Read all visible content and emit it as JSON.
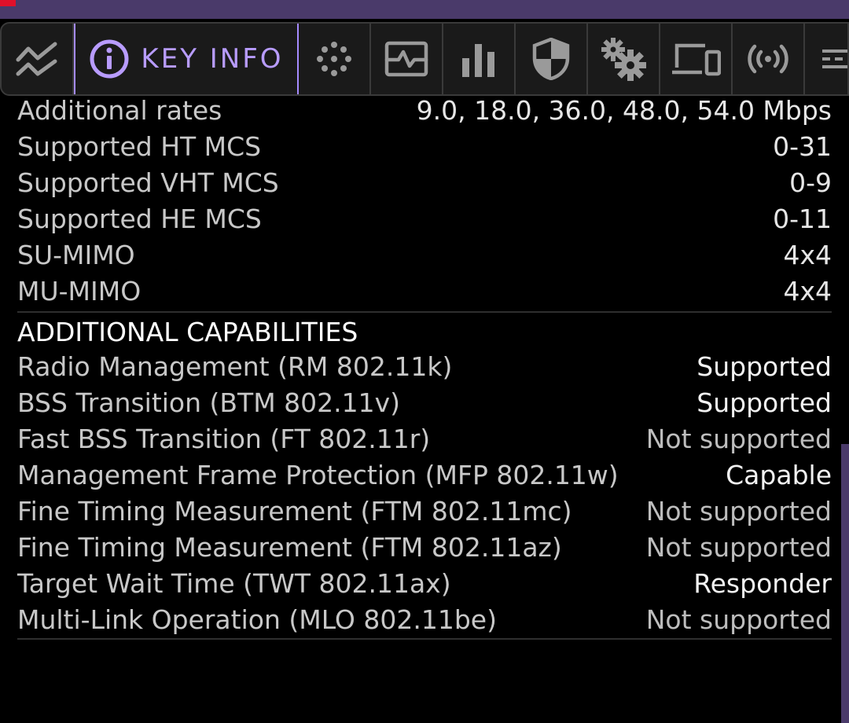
{
  "toolbar": {
    "tabs": [
      {
        "icon": "chart-line-icon"
      },
      {
        "icon": "info-circle-icon",
        "label": "KEY INFO",
        "active": true
      },
      {
        "icon": "dots-grid-icon"
      },
      {
        "icon": "signal-graph-icon"
      },
      {
        "icon": "bar-chart-icon"
      },
      {
        "icon": "shield-icon"
      },
      {
        "icon": "gears-icon"
      },
      {
        "icon": "devices-icon"
      },
      {
        "icon": "broadcast-icon"
      },
      {
        "icon": "more-icon"
      }
    ],
    "accent_color": "#a58bff"
  },
  "rates": [
    {
      "key": "Additional rates",
      "value": "9.0, 18.0, 36.0, 48.0, 54.0 Mbps"
    },
    {
      "key": "Supported HT MCS",
      "value": "0-31"
    },
    {
      "key": "Supported VHT MCS",
      "value": "0-9"
    },
    {
      "key": "Supported HE MCS",
      "value": "0-11"
    },
    {
      "key": "SU-MIMO",
      "value": "4x4"
    },
    {
      "key": "MU-MIMO",
      "value": "4x4"
    }
  ],
  "additional_capabilities": {
    "title": "ADDITIONAL CAPABILITIES",
    "items": [
      {
        "key": "Radio Management (RM 802.11k)",
        "value": "Supported"
      },
      {
        "key": "BSS Transition (BTM 802.11v)",
        "value": "Supported"
      },
      {
        "key": "Fast BSS Transition (FT 802.11r)",
        "value": "Not supported"
      },
      {
        "key": "Management Frame Protection (MFP 802.11w)",
        "value": "Capable"
      },
      {
        "key": "Fine Timing Measurement (FTM 802.11mc)",
        "value": "Not supported"
      },
      {
        "key": "Fine Timing Measurement (FTM 802.11az)",
        "value": "Not supported"
      },
      {
        "key": "Target Wait Time (TWT 802.11ax)",
        "value": "Responder"
      },
      {
        "key": "Multi-Link Operation (MLO 802.11be)",
        "value": "Not supported"
      }
    ]
  }
}
